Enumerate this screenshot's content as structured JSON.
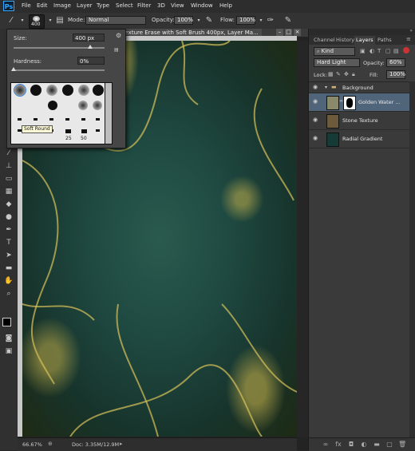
{
  "menu": {
    "logo": "Ps",
    "items": [
      "File",
      "Edit",
      "Image",
      "Layer",
      "Type",
      "Select",
      "Filter",
      "3D",
      "View",
      "Window",
      "Help"
    ]
  },
  "options": {
    "brush_size": "400",
    "mode_label": "Mode:",
    "mode_value": "Normal",
    "opacity_label": "Opacity:",
    "opacity_value": "100%",
    "flow_label": "Flow:",
    "flow_value": "100%"
  },
  "brush_picker": {
    "size_label": "Size:",
    "size_value": "400 px",
    "size_fraction": 0.84,
    "hardness_label": "Hardness:",
    "hardness_value": "0%",
    "hardness_fraction": 0.0,
    "tooltip": "Soft Round",
    "sizes": [
      "25",
      "50"
    ]
  },
  "document": {
    "tab_title": "er Texture  Erase with Soft Brush 400px, Layer Ma...",
    "zoom": "66.67%",
    "doc_info": "Doc: 3.35M/12.9M"
  },
  "panels": {
    "tabs": [
      "Channel",
      "History",
      "Layers",
      "Paths"
    ],
    "active_tab": "Layers",
    "kind_label": "Kind",
    "blend_mode": "Hard Light",
    "opacity_label": "Opacity:",
    "opacity_value": "60%",
    "lock_label": "Lock:",
    "fill_label": "Fill:",
    "fill_value": "100%",
    "group_name": "Background",
    "layers": [
      {
        "name": "Golden Water ...",
        "selected": true,
        "color": "#8a8a6a"
      },
      {
        "name": "Stone Texture",
        "selected": false,
        "color": "#6b5a3c"
      },
      {
        "name": "Radial Gradient",
        "selected": false,
        "color": "#163a36"
      }
    ]
  },
  "colors": {
    "accent": "#31a8ff",
    "selected_row": "#51657a"
  }
}
